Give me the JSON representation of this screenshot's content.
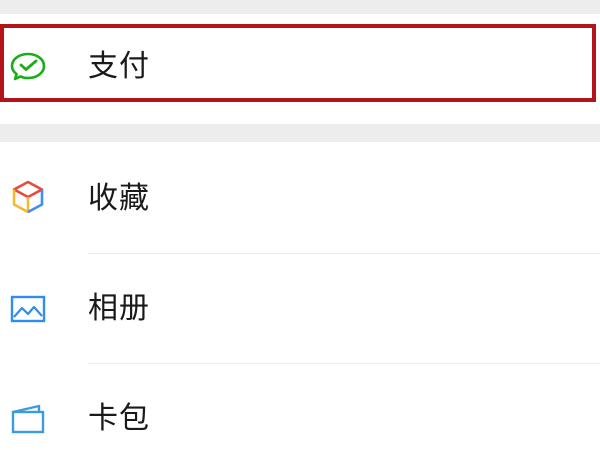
{
  "menu": {
    "pay": {
      "label": "支付",
      "icon": "wechat-pay-icon"
    },
    "favorites": {
      "label": "收藏",
      "icon": "cube-icon"
    },
    "album": {
      "label": "相册",
      "icon": "image-icon"
    },
    "cards": {
      "label": "卡包",
      "icon": "card-wallet-icon"
    }
  },
  "colors": {
    "highlight_border": "#b3141a",
    "pay_green": "#1aad19",
    "album_blue": "#2f8cf0",
    "cards_blue": "#3a9be0",
    "separator_gray": "#ededed"
  }
}
